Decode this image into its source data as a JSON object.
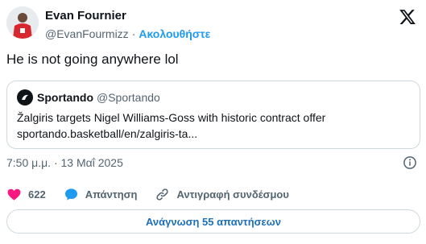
{
  "author": {
    "name": "Evan Fournier",
    "handle": "@EvanFourmizz",
    "separator": "·",
    "follow_label": "Ακολουθήστε"
  },
  "tweet": {
    "text": "He is not going anywhere lol",
    "timestamp": "7:50 μ.μ. · 13 Μαΐ 2025"
  },
  "quote": {
    "name": "Sportando",
    "handle": "@Sportando",
    "line1": "Žalgiris targets Nigel Williams-Goss with historic contract offer",
    "line2": "sportando.basketball/en/zalgiris-ta..."
  },
  "actions": {
    "likes_count": "622",
    "reply_label": "Απάντηση",
    "copy_link_label": "Αντιγραφή συνδέσμου"
  },
  "read_replies_label": "Ανάγνωση 55 απαντήσεων",
  "colors": {
    "accent": "#1d9bf0",
    "heart": "#f91880",
    "text": "#0f1419",
    "secondary": "#536471",
    "border": "#cfd9de"
  }
}
